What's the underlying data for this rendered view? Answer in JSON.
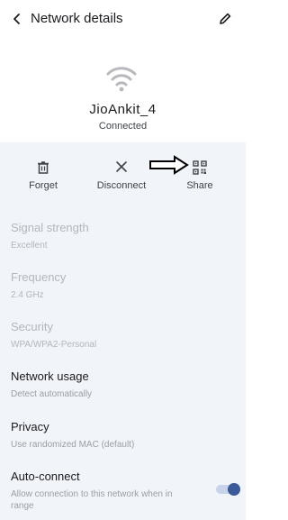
{
  "header": {
    "title": "Network details"
  },
  "network": {
    "ssid": "JioAnkit_4",
    "status": "Connected"
  },
  "actions": [
    {
      "label": "Forget",
      "icon": "trash-icon"
    },
    {
      "label": "Disconnect",
      "icon": "close-icon"
    },
    {
      "label": "Share",
      "icon": "qr-code-icon"
    }
  ],
  "details": [
    {
      "label": "Signal strength",
      "value": "Excellent"
    },
    {
      "label": "Frequency",
      "value": "2.4 GHz"
    },
    {
      "label": "Security",
      "value": "WPA/WPA2-Personal"
    },
    {
      "label": "Network usage",
      "value": "Detect automatically"
    },
    {
      "label": "Privacy",
      "value": "Use randomized MAC (default)"
    },
    {
      "label": "Auto-connect",
      "value": "Allow connection to this network when in range"
    }
  ],
  "auto_connect_enabled": true,
  "colors": {
    "background": "#f1f4f9",
    "accent": "#3b5a9a"
  }
}
